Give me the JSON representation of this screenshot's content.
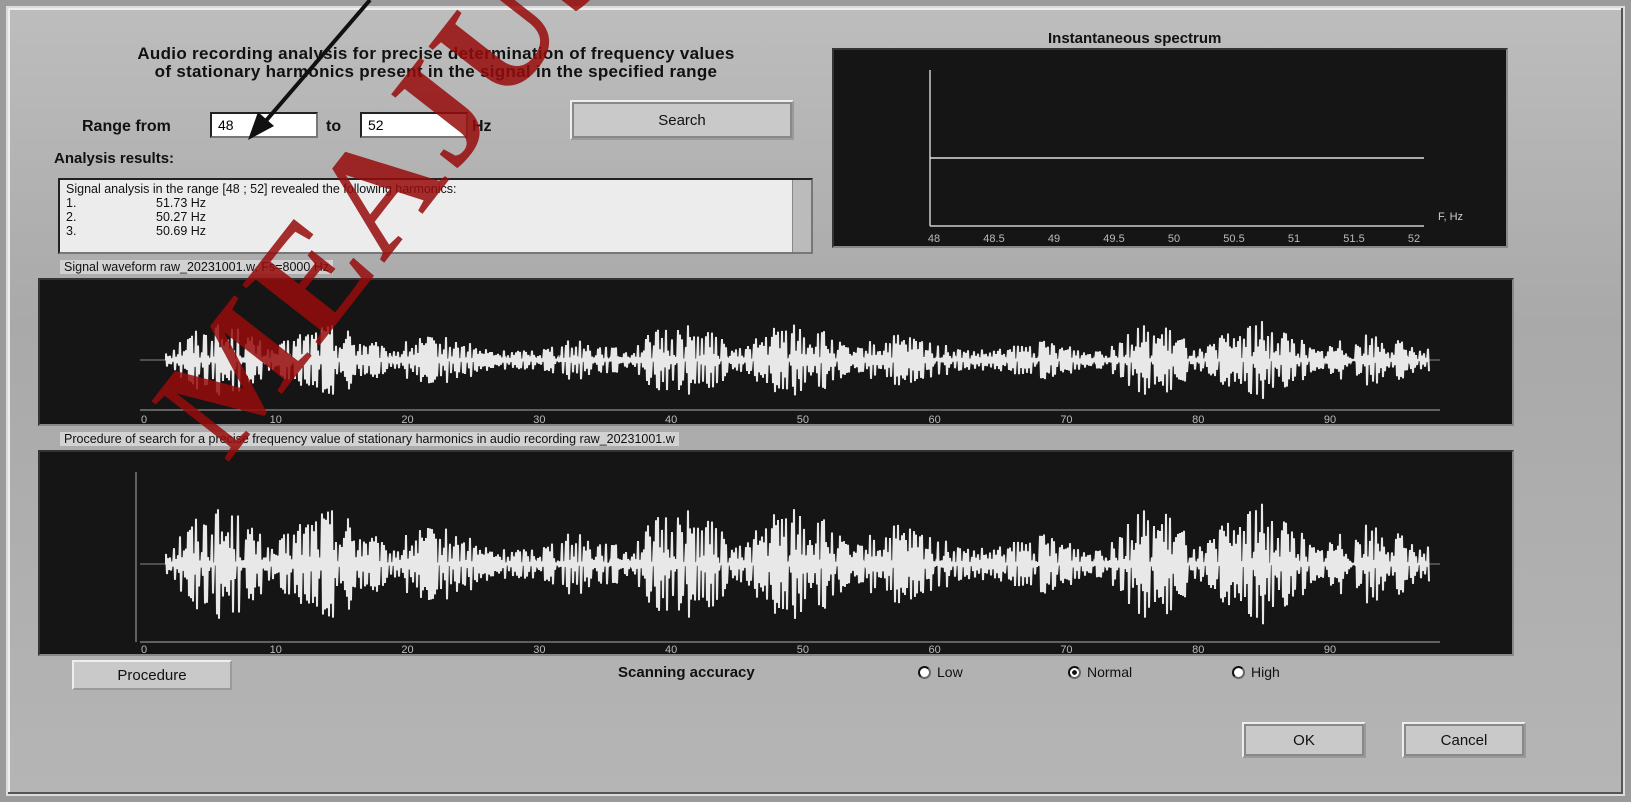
{
  "header": {
    "title_line1": "Audio recording analysis for precise determination of frequency values",
    "title_line2": "of stationary harmonics present in the signal in the specified range"
  },
  "range": {
    "from_label": "Range from",
    "from_value": "48",
    "to_label": "to",
    "to_value": "52",
    "unit": "Hz",
    "search_label": "Search"
  },
  "results": {
    "heading": "Analysis results:",
    "summary": "Signal analysis in the range [48 ; 52] revealed the following harmonics:",
    "items": [
      {
        "num": "1.",
        "value": "51.73 Hz"
      },
      {
        "num": "2.",
        "value": "50.27 Hz"
      },
      {
        "num": "3.",
        "value": "50.69 Hz"
      }
    ]
  },
  "spectrum": {
    "title": "Instantaneous spectrum",
    "x_ticks": [
      "48",
      "48.5",
      "49",
      "49.5",
      "50",
      "50.5",
      "51",
      "51.5",
      "52"
    ],
    "x_unit": "F, Hz"
  },
  "waveform": {
    "caption": "Signal waveform raw_20231001.w, Fs=8000 Hz",
    "x_ticks": [
      "0",
      "10",
      "20",
      "30",
      "40",
      "50",
      "60",
      "70",
      "80",
      "90"
    ]
  },
  "detail": {
    "caption": "Procedure of search for a precise frequency value of stationary harmonics in audio recording raw_20231001.w",
    "x_ticks": [
      "0",
      "10",
      "20",
      "30",
      "40",
      "50",
      "60",
      "70",
      "80",
      "90"
    ]
  },
  "controls": {
    "procedure_label": "Procedure",
    "accuracy_label": "Scanning accuracy",
    "options": [
      {
        "label": "Low",
        "selected": false
      },
      {
        "label": "Normal",
        "selected": true
      },
      {
        "label": "High",
        "selected": false
      }
    ],
    "ok_label": "OK",
    "cancel_label": "Cancel"
  },
  "watermark": {
    "text": "MEAJUSTICE"
  },
  "colors": {
    "watermark": "#960a0a",
    "panel_bg": "#151515",
    "trace": "#e8e8e8"
  }
}
